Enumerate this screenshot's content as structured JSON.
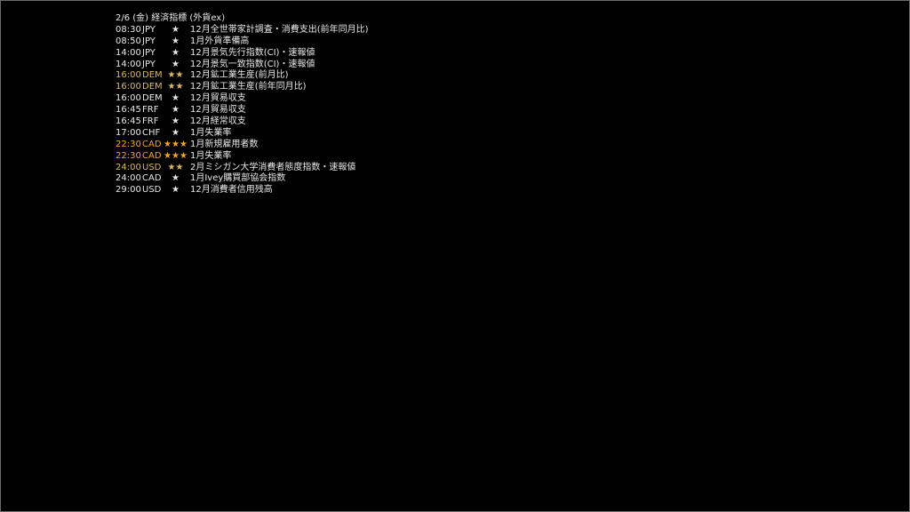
{
  "title": "2/6 (金) 経済指標 (外貨ex)",
  "colors": {
    "text": "#e8e8e8",
    "medium_importance": "#d9b86a",
    "high_importance": "#f5a623",
    "background": "#000000"
  },
  "events": [
    {
      "time": "08:30",
      "currency": "JPY",
      "stars": "★",
      "importance": 1,
      "name": "12月全世帯家計調査・消費支出(前年同月比)"
    },
    {
      "time": "08:50",
      "currency": "JPY",
      "stars": "★",
      "importance": 1,
      "name": "1月外貨準備高"
    },
    {
      "time": "14:00",
      "currency": "JPY",
      "stars": "★",
      "importance": 1,
      "name": "12月景気先行指数(CI)・速報値"
    },
    {
      "time": "14:00",
      "currency": "JPY",
      "stars": "★",
      "importance": 1,
      "name": "12月景気一致指数(CI)・速報値"
    },
    {
      "time": "16:00",
      "currency": "DEM",
      "stars": "★★",
      "importance": 2,
      "name": "12月鉱工業生産(前月比)"
    },
    {
      "time": "16:00",
      "currency": "DEM",
      "stars": "★★",
      "importance": 2,
      "name": "12月鉱工業生産(前年同月比)"
    },
    {
      "time": "16:00",
      "currency": "DEM",
      "stars": "★",
      "importance": 1,
      "name": "12月貿易収支"
    },
    {
      "time": "16:45",
      "currency": "FRF",
      "stars": "★",
      "importance": 1,
      "name": "12月貿易収支"
    },
    {
      "time": "16:45",
      "currency": "FRF",
      "stars": "★",
      "importance": 1,
      "name": "12月経常収支"
    },
    {
      "time": "17:00",
      "currency": "CHF",
      "stars": "★",
      "importance": 1,
      "name": "1月失業率"
    },
    {
      "time": "22:30",
      "currency": "CAD",
      "stars": "★★★",
      "importance": 3,
      "name": "1月新規雇用者数"
    },
    {
      "time": "22:30",
      "currency": "CAD",
      "stars": "★★★",
      "importance": 3,
      "name": "1月失業率"
    },
    {
      "time": "24:00",
      "currency": "USD",
      "stars": "★★",
      "importance": 2,
      "name": "2月ミシガン大学消費者態度指数・速報値"
    },
    {
      "time": "24:00",
      "currency": "CAD",
      "stars": "★",
      "importance": 1,
      "name": "1月Ivey購買部協会指数"
    },
    {
      "time": "29:00",
      "currency": "USD",
      "stars": "★",
      "importance": 1,
      "name": "12月消費者信用残高"
    }
  ]
}
